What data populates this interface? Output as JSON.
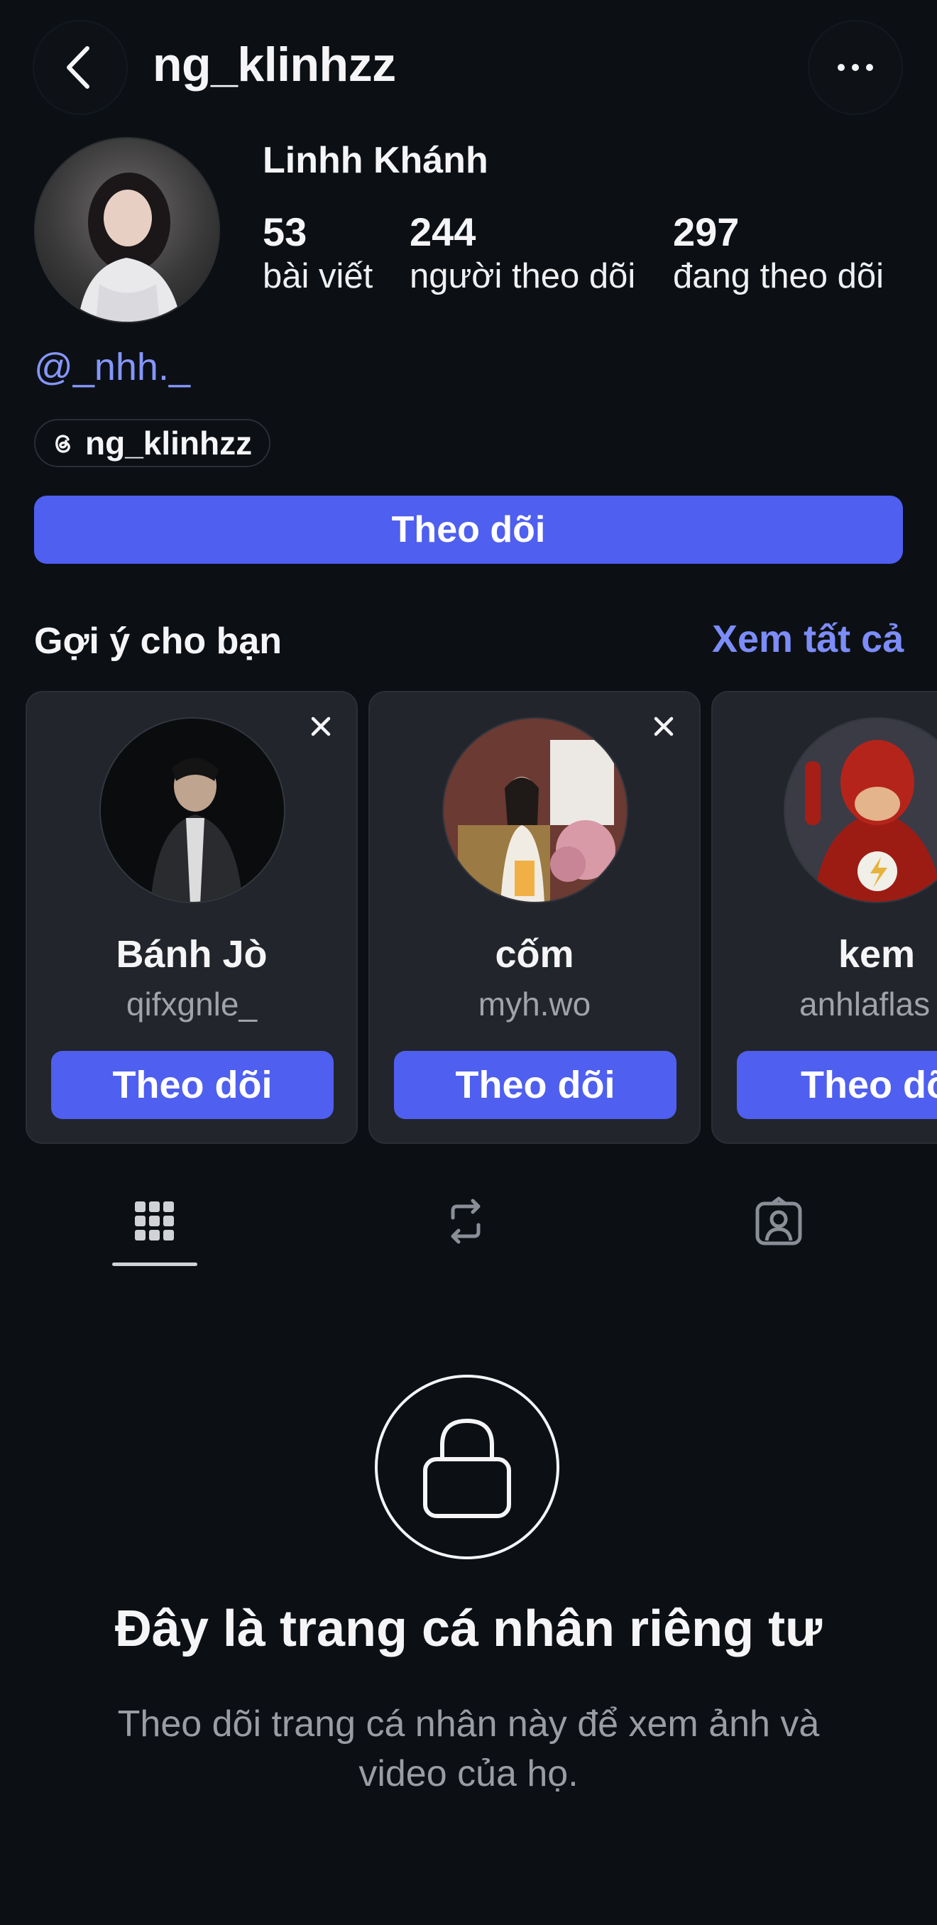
{
  "header": {
    "username": "ng_klinhzz",
    "back_icon": "chevron-left-icon",
    "more_icon": "ellipsis-icon"
  },
  "profile": {
    "display_name": "Linhh Khánh",
    "stats": [
      {
        "value": "53",
        "label": "bài viết"
      },
      {
        "value": "244",
        "label": "người theo dõi"
      },
      {
        "value": "297",
        "label": "đang theo dõi"
      }
    ],
    "mention": "@_nhh._",
    "threads_handle": "ng_klinhzz",
    "follow_label": "Theo dõi"
  },
  "suggestions": {
    "title": "Gợi ý cho bạn",
    "see_all": "Xem tất cả",
    "cards": [
      {
        "name": "Bánh Jò",
        "handle": "qifxgnle_",
        "follow_label": "Theo dõi"
      },
      {
        "name": "cốm",
        "handle": "myh.wo",
        "follow_label": "Theo dõi"
      },
      {
        "name": "kem",
        "handle": "anhlaflas",
        "follow_label": "Theo dõi"
      }
    ]
  },
  "tabs": [
    {
      "icon": "grid-icon",
      "active": true
    },
    {
      "icon": "repost-icon",
      "active": false
    },
    {
      "icon": "tagged-icon",
      "active": false
    }
  ],
  "private": {
    "title": "Đây là trang cá nhân riêng tư",
    "description": "Theo dõi trang cá nhân này để xem ảnh và video của họ."
  },
  "colors": {
    "background": "#0c1015",
    "accent": "#4f5fef",
    "link": "#7c8cf8"
  }
}
